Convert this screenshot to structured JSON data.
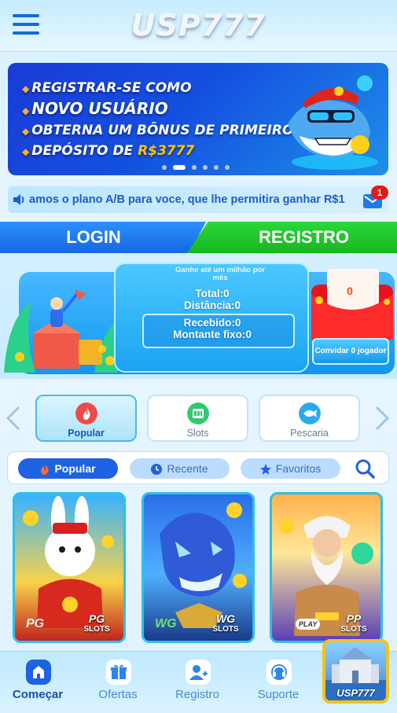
{
  "header": {
    "logo_text": "USP777"
  },
  "banner": {
    "lines": [
      "REGISTRAR-SE COMO",
      "NOVO USUÁRIO",
      "OBTERNA UM BÔNUS DE PRIMEIRO",
      "DEPÓSITO DE"
    ],
    "amount": "R$3777"
  },
  "marquee": {
    "text": "amos o plano A/B para voce, que lhe permitira ganhar R$1",
    "mail_badge": "1"
  },
  "auth": {
    "login_label": "LOGIN",
    "register_label": "REGISTRO"
  },
  "promo": {
    "subtitle": "Ganhe até um milhão por mês",
    "total": "Total:0",
    "distance": "Distância:0",
    "received": "Recebido:0",
    "fixed_amount": "Montante fixo:0",
    "envelope_value": "0",
    "invite_label": "Convidar 0 jogador"
  },
  "categories": [
    {
      "label": "Popular",
      "icon": "flame-icon",
      "active": true
    },
    {
      "label": "Slots",
      "icon": "slot-machine-icon",
      "active": false
    },
    {
      "label": "Pescaria",
      "icon": "fish-icon",
      "active": false
    }
  ],
  "filters": [
    {
      "label": "Popular",
      "icon": "flame-icon",
      "active": true
    },
    {
      "label": "Recente",
      "icon": "clock-icon",
      "active": false
    },
    {
      "label": "Favoritos",
      "icon": "star-icon",
      "active": false
    }
  ],
  "games": [
    {
      "provider": "PG",
      "tag_top": "PG",
      "tag_bottom": "SLOTS"
    },
    {
      "provider": "WG",
      "tag_top": "WG",
      "tag_bottom": "SLOTS"
    },
    {
      "provider": "PLAY",
      "tag_top": "PP",
      "tag_bottom": "SLOTS"
    }
  ],
  "bottom_nav": [
    {
      "label": "Começar",
      "icon": "home-icon",
      "active": true
    },
    {
      "label": "Ofertas",
      "icon": "gift-icon",
      "active": false
    },
    {
      "label": "Registro",
      "icon": "user-add-icon",
      "active": false
    },
    {
      "label": "Suporte",
      "icon": "headset-icon",
      "active": false
    }
  ],
  "corner_promo": {
    "label": "USP777"
  },
  "colors": {
    "primary_blue": "#1d62e3",
    "register_green": "#15b81f",
    "accent_gold": "#ffc20e",
    "badge_red": "#e51919"
  }
}
